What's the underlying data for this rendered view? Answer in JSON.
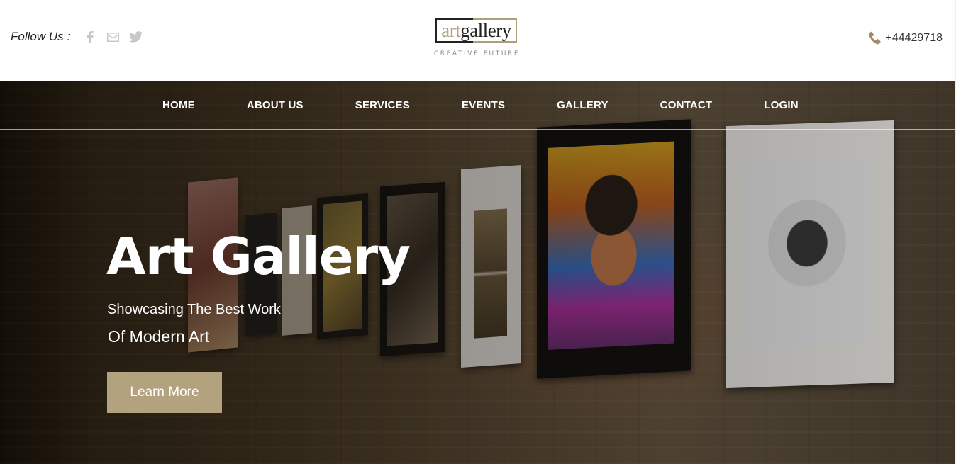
{
  "header": {
    "follow_label": "Follow Us :",
    "social": [
      {
        "icon": "facebook-icon"
      },
      {
        "icon": "mail-icon"
      },
      {
        "icon": "twitter-icon"
      }
    ],
    "logo": {
      "art": "art",
      "gallery": "gallery",
      "tagline": "CREATIVE FUTURE"
    },
    "phone": {
      "icon": "phone-icon",
      "number": "+44429718"
    }
  },
  "nav": {
    "items": [
      {
        "label": "HOME"
      },
      {
        "label": "ABOUT US"
      },
      {
        "label": "SERVICES"
      },
      {
        "label": "EVENTS"
      },
      {
        "label": "GALLERY"
      },
      {
        "label": "CONTACT"
      },
      {
        "label": "LOGIN"
      }
    ]
  },
  "hero": {
    "title": "Art Gallery",
    "subtitle_line1": "Showcasing The Best Work",
    "subtitle_line2": "Of Modern Art",
    "cta_label": "Learn More"
  },
  "colors": {
    "accent": "#b3a27e",
    "text_dark": "#222222",
    "nav_text": "#ffffff"
  }
}
